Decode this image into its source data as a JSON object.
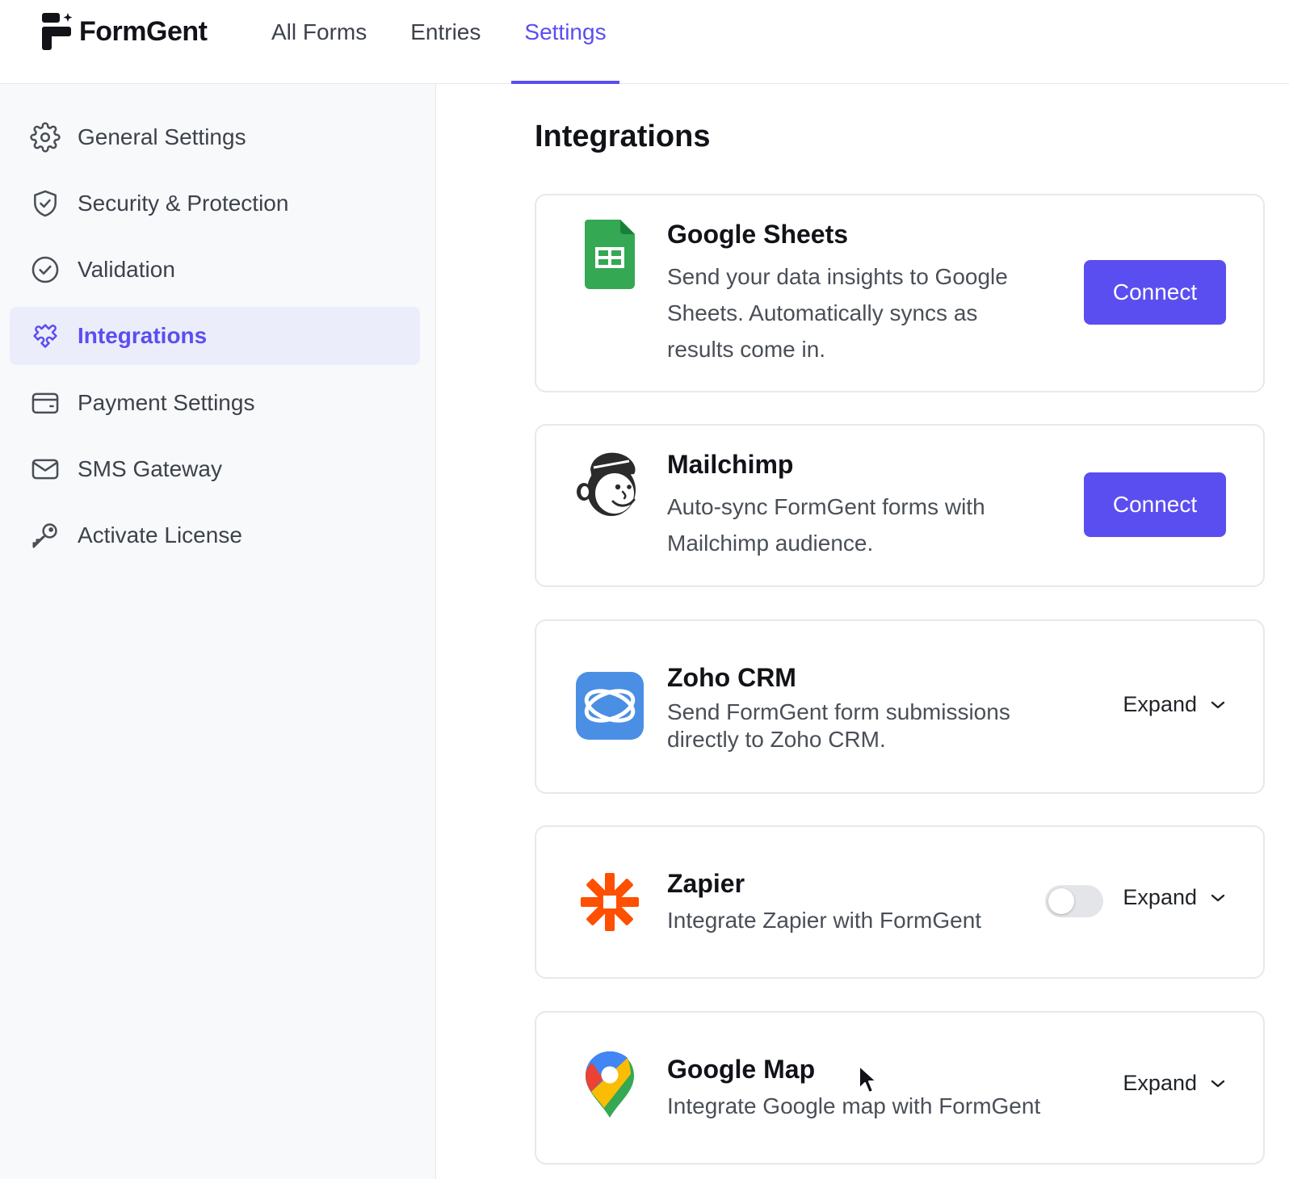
{
  "app": {
    "name": "FormGent"
  },
  "nav": {
    "items": [
      {
        "label": "All Forms",
        "active": false
      },
      {
        "label": "Entries",
        "active": false
      },
      {
        "label": "Settings",
        "active": true
      }
    ]
  },
  "sidebar": {
    "items": [
      {
        "label": "General Settings",
        "icon": "gear-icon",
        "active": false
      },
      {
        "label": "Security & Protection",
        "icon": "shield-icon",
        "active": false
      },
      {
        "label": "Validation",
        "icon": "check-circle-icon",
        "active": false
      },
      {
        "label": "Integrations",
        "icon": "puzzle-icon",
        "active": true
      },
      {
        "label": "Payment Settings",
        "icon": "wallet-icon",
        "active": false
      },
      {
        "label": "SMS Gateway",
        "icon": "envelope-icon",
        "active": false
      },
      {
        "label": "Activate License",
        "icon": "key-icon",
        "active": false
      }
    ]
  },
  "main": {
    "title": "Integrations",
    "integrations": [
      {
        "name": "Google Sheets",
        "icon": "google-sheets-icon",
        "description": "Send your data insights to Google Sheets. Automatically syncs as results come in.",
        "action": "Connect"
      },
      {
        "name": "Mailchimp",
        "icon": "mailchimp-icon",
        "description": "Auto-sync FormGent forms with Mailchimp audience.",
        "action": "Connect"
      },
      {
        "name": "Zoho CRM",
        "icon": "zoho-crm-icon",
        "description": "Send FormGent form submissions directly to Zoho CRM.",
        "action": "Expand"
      },
      {
        "name": "Zapier",
        "icon": "zapier-icon",
        "description": "Integrate Zapier with FormGent",
        "action": "Expand",
        "toggle_on": false
      },
      {
        "name": "Google Map",
        "icon": "google-map-icon",
        "description": "Integrate Google map with FormGent",
        "action": "Expand"
      }
    ]
  },
  "colors": {
    "accent": "#5b4ef0",
    "sidebar_bg": "#f8f9fb",
    "active_bg": "#ecedfb"
  }
}
